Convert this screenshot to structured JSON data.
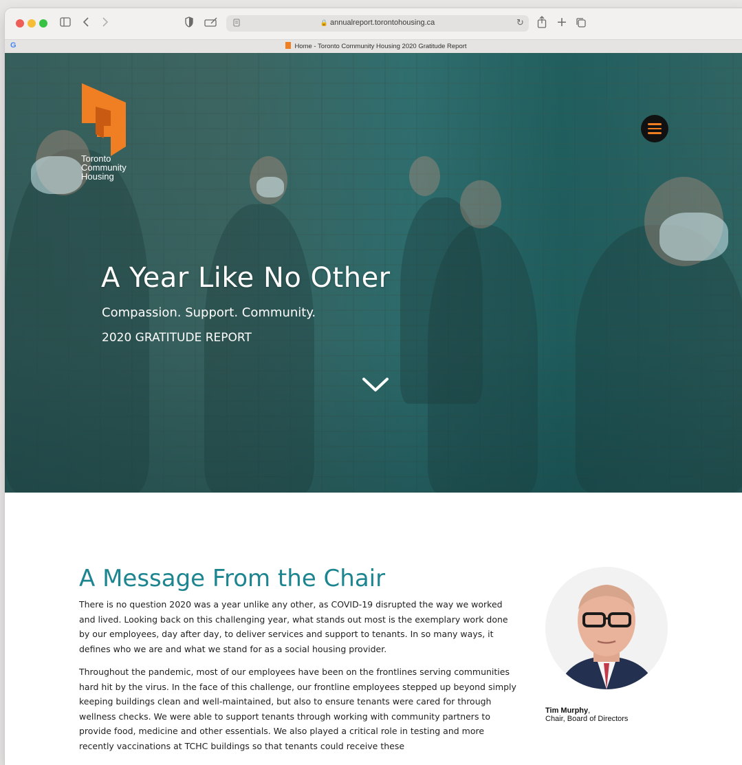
{
  "browser": {
    "url": "annualreport.torontohousing.ca",
    "tab_title": "Home - Toronto Community Housing 2020 Gratitude Report",
    "favicon_left": "G"
  },
  "hero": {
    "logo_lines": [
      "Toronto",
      "Community",
      "Housing"
    ],
    "title": "A Year Like No Other",
    "subtitle": "Compassion. Support. Community.",
    "report": "2020 GRATITUDE REPORT",
    "accent_color": "#f07f23",
    "overlay_color": "#0a6e6e"
  },
  "message": {
    "title": "A Message From the Chair",
    "title_color": "#1d8590",
    "paragraph1": "There is no question 2020 was a year unlike any other, as COVID-19 disrupted the way we worked and lived. Looking back on this challenging year, what stands out most is the exemplary work done by our employees, day after day, to deliver services and support to tenants. In so many ways, it defines who we are and what we stand for as a social housing provider.",
    "paragraph2": "Throughout the pandemic, most of our employees have been on the frontlines serving communities hard hit by the virus. In the face of this challenge, our frontline employees stepped up beyond simply keeping buildings clean and well-maintained, but also to ensure tenants were cared for through wellness checks.  We were able to support tenants through working with community partners to provide food, medicine and other essentials. We also played a critical role in testing and more recently vaccinations at TCHC buildings so that tenants could receive these",
    "chair_name": "Tim Murphy",
    "chair_role": "Chair, Board of Directors"
  }
}
